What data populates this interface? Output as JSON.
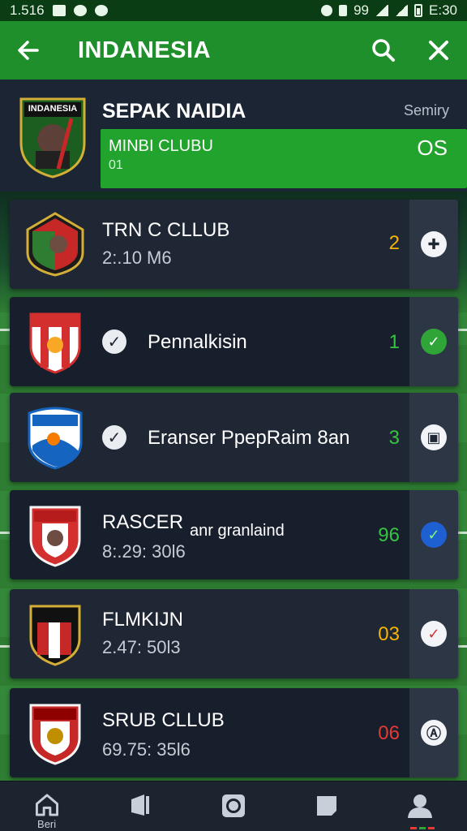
{
  "status_bar": {
    "time_left": "1.516",
    "network": "99",
    "time_right": "E:30"
  },
  "app_bar": {
    "title": "INDANESIA",
    "back_icon": "arrow-left-icon",
    "search_icon": "search-icon",
    "close_icon": "close-icon"
  },
  "featured": {
    "crest_text": "INDANESIA",
    "name": "SEPAK NAIDIA",
    "status": "Semiry",
    "line1": "MINBI CLUBU",
    "line2": "01",
    "score": "OS"
  },
  "matches": [
    {
      "crest_color": "#c62828",
      "title": "TRN C CLLUB",
      "subtitle": "2:.10 M6",
      "has_check": false,
      "score": "2",
      "score_color": "#f4b400",
      "side_icon": "puzzle-icon",
      "side_color": "#1f2735"
    },
    {
      "crest_color": "#d32f2f",
      "title": "Pennalkisin",
      "subtitle": "",
      "has_check": true,
      "score": "1",
      "score_color": "#35c53f",
      "side_icon": "check-circle-icon",
      "side_color": "#2fa437"
    },
    {
      "crest_color": "#1565c0",
      "title": "Eranser PpepRaim 8an",
      "subtitle": "",
      "has_check": true,
      "score": "3",
      "score_color": "#35c53f",
      "side_icon": "clipboard-icon",
      "side_color": "#1f2735"
    },
    {
      "crest_color": "#d32f2f",
      "title": "RASCER",
      "title_extra": "anr granlaind",
      "subtitle": "8:.29: 30l6",
      "has_check": false,
      "score": "96",
      "score_color": "#35c53f",
      "side_icon": "check-circle-icon",
      "side_color": "#1e5fd1"
    },
    {
      "crest_color": "#b71c1c",
      "title": "FLMKIJN",
      "subtitle": "2.47: 50l3",
      "has_check": false,
      "score": "03",
      "score_color": "#f4b400",
      "side_icon": "check-circle-icon",
      "side_color": "#d32f2f"
    },
    {
      "crest_color": "#c62828",
      "title": "SRUB CLLUB",
      "subtitle": "69.75: 35l6",
      "has_check": false,
      "score": "06",
      "score_color": "#e53935",
      "side_icon": "user-circle-icon",
      "side_color": "#1f2735"
    }
  ],
  "bottom_nav": [
    {
      "icon": "home-icon",
      "label": "Beri"
    },
    {
      "icon": "news-icon",
      "label": ""
    },
    {
      "icon": "record-icon",
      "label": ""
    },
    {
      "icon": "chat-icon",
      "label": ""
    },
    {
      "icon": "profile-icon",
      "label": ""
    }
  ],
  "colors": {
    "app_bar": "#1e8f2a",
    "highlight": "#22a32e",
    "card": "#1f2735"
  }
}
